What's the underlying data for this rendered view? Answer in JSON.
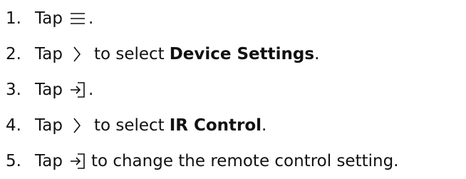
{
  "steps": [
    {
      "number": "1",
      "tap": "Tap",
      "icon": "menu-icon",
      "after_icon": ".",
      "bold": "",
      "end": ""
    },
    {
      "number": "2",
      "tap": "Tap",
      "icon": "chevron-right-icon",
      "after_icon": "to select",
      "bold": "Device Settings",
      "end": "."
    },
    {
      "number": "3",
      "tap": "Tap",
      "icon": "enter-icon",
      "after_icon": ".",
      "bold": "",
      "end": ""
    },
    {
      "number": "4",
      "tap": "Tap",
      "icon": "chevron-right-icon",
      "after_icon": "to select",
      "bold": "IR Control",
      "end": "."
    },
    {
      "number": "5",
      "tap": "Tap",
      "icon": "enter-icon",
      "after_icon": "to change the remote control setting.",
      "bold": "",
      "end": ""
    }
  ]
}
